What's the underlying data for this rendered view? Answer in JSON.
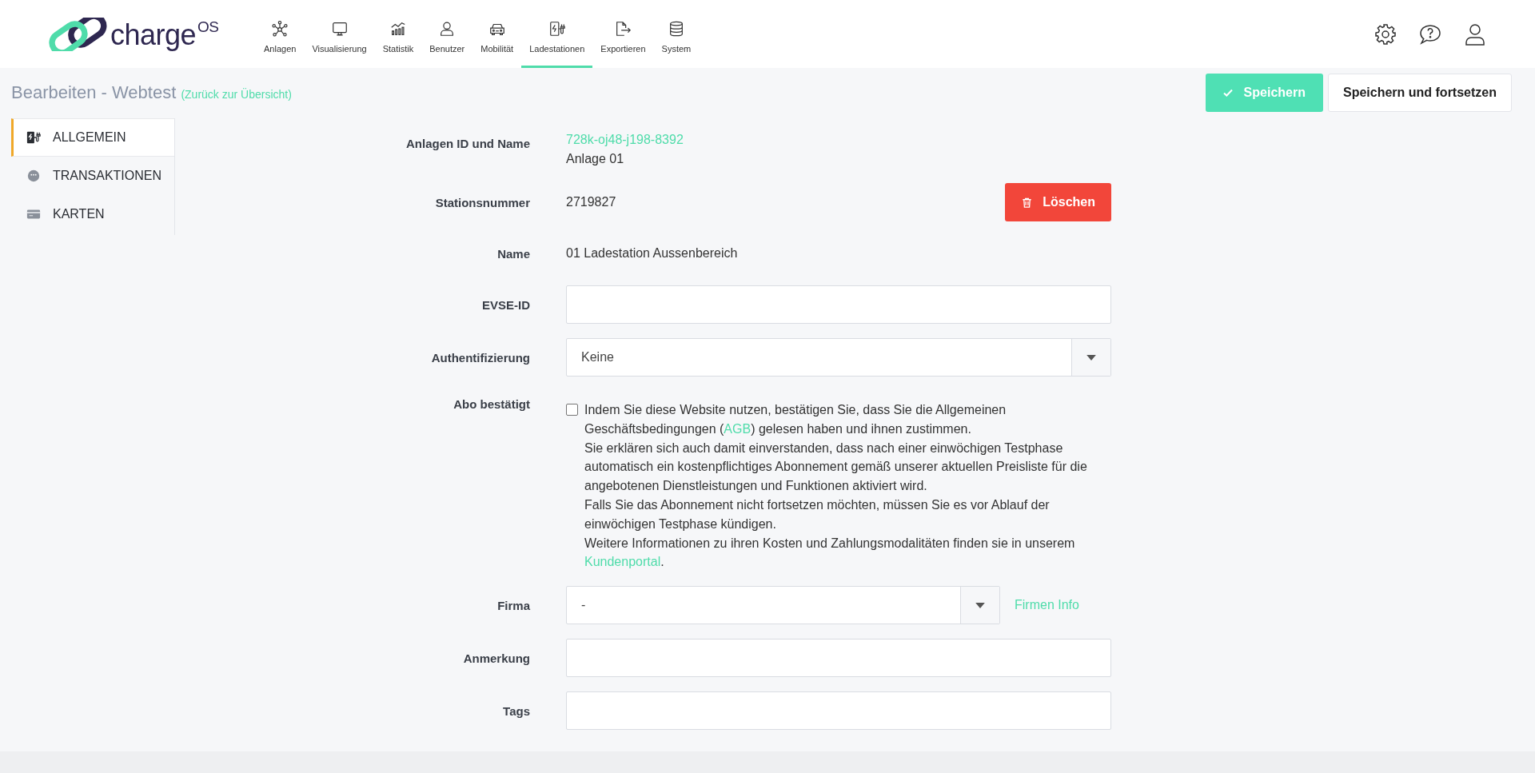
{
  "logo": {
    "text": "charge",
    "superscript": "OS"
  },
  "nav": [
    {
      "label": "Anlagen",
      "selected": false
    },
    {
      "label": "Visualisierung",
      "selected": false
    },
    {
      "label": "Statistik",
      "selected": false
    },
    {
      "label": "Benutzer",
      "selected": false
    },
    {
      "label": "Mobilität",
      "selected": false
    },
    {
      "label": "Ladestationen",
      "selected": true
    },
    {
      "label": "Exportieren",
      "selected": false
    },
    {
      "label": "System",
      "selected": false
    }
  ],
  "page": {
    "title": "Bearbeiten - Webtest",
    "back_link": "(Zurück zur Übersicht)"
  },
  "buttons": [
    {
      "label": "Speichern",
      "kind": "primary"
    },
    {
      "label": "Speichern und fortsetzen",
      "kind": "secondary"
    }
  ],
  "sidebar": {
    "items": [
      {
        "label": "ALLGEMEIN",
        "selected": true
      },
      {
        "label": "TRANSAKTIONEN",
        "selected": false
      },
      {
        "label": "KARTEN",
        "selected": false
      }
    ]
  },
  "form": {
    "rows": [
      {
        "kind": "id",
        "label": "Anlagen ID und Name",
        "link": "728k-oj48-j198-8392",
        "value": "Anlage 01"
      },
      {
        "kind": "text",
        "label": "Stationsnummer",
        "value": "2719827",
        "action": "Löschen"
      },
      {
        "kind": "text",
        "label": "Name",
        "value": "01 Ladestation Aussenbereich"
      },
      {
        "kind": "input",
        "label": "EVSE-ID"
      },
      {
        "kind": "select",
        "label": "Authentifizierung",
        "value": "Keine"
      },
      {
        "kind": "checkbox",
        "label": "Abo bestätigt",
        "checked": false,
        "paragraphs": [
          [
            {
              "text": "Indem Sie diese Website nutzen, bestätigen Sie, dass Sie die Allgemeinen Geschäftsbedingungen ("
            },
            {
              "link": "AGB"
            },
            {
              "text": ") gelesen haben und ihnen zustimmen."
            }
          ],
          [
            {
              "text": "Sie erklären sich auch damit einverstanden, dass nach einer einwöchigen Testphase automatisch ein kostenpflichtiges Abonnement gemäß unserer aktuellen Preisliste für die angebotenen Dienstleistungen und Funktionen aktiviert wird."
            }
          ],
          [
            {
              "text": "Falls Sie das Abonnement nicht fortsetzen möchten, müssen Sie es vor Ablauf der einwöchigen Testphase kündigen."
            }
          ],
          [
            {
              "text": "Weitere Informationen zu ihren Kosten und Zahlungsmodalitäten finden sie in unserem "
            },
            {
              "link": "Kundenportal"
            },
            {
              "text": "."
            }
          ]
        ]
      },
      {
        "kind": "select",
        "label": "Firma",
        "value": "-",
        "link": "Firmen Info"
      },
      {
        "kind": "input",
        "label": "Anmerkung"
      },
      {
        "kind": "input",
        "label": "Tags"
      }
    ]
  }
}
